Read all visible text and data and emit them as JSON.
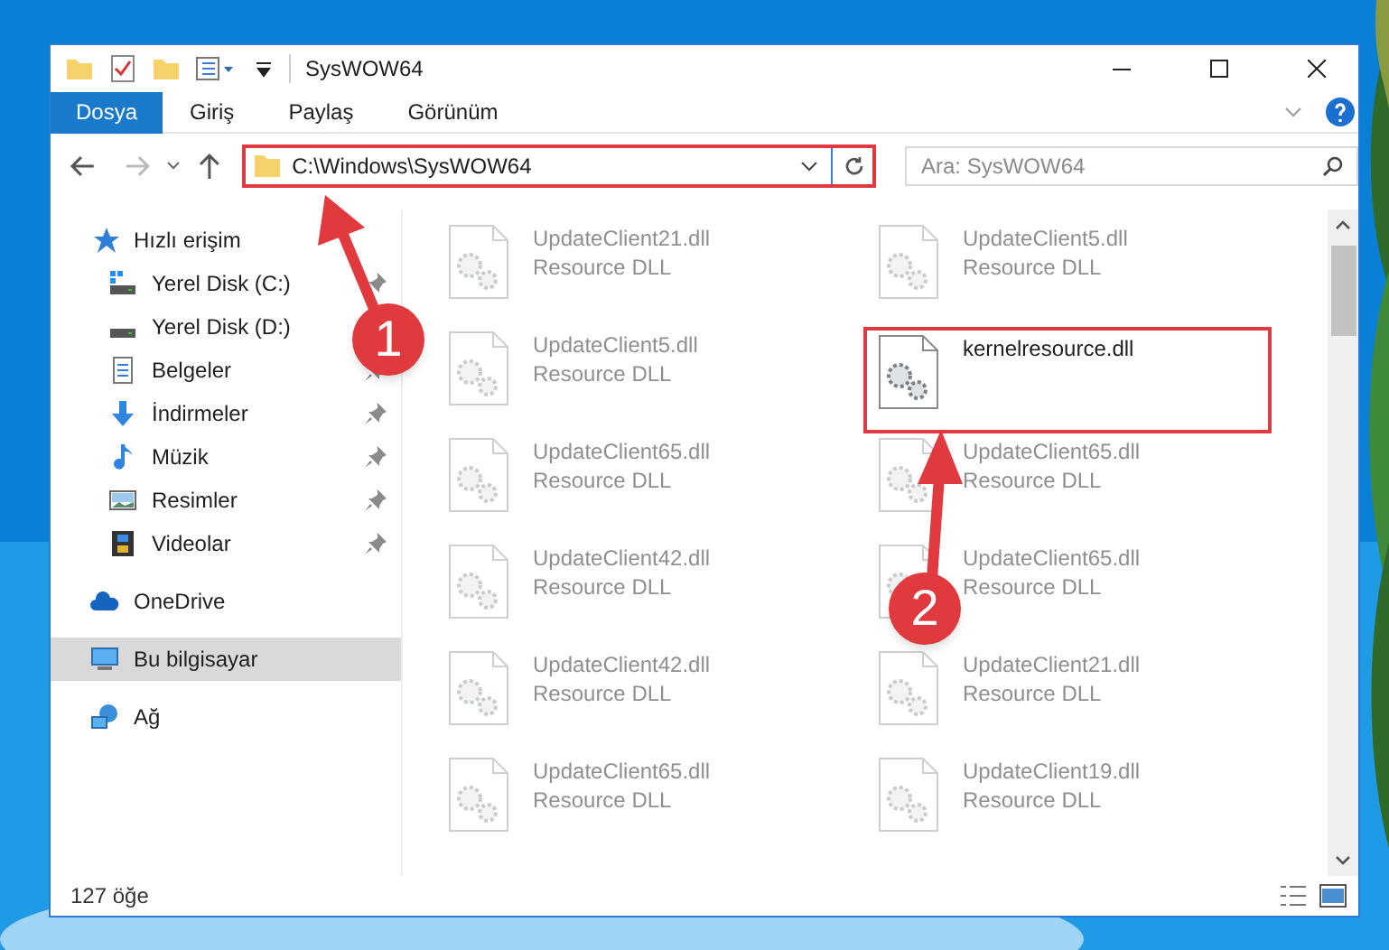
{
  "window": {
    "title": "SysWOW64"
  },
  "ribbon_tabs": [
    {
      "label": "Dosya",
      "kind": "file"
    },
    {
      "label": "Giriş",
      "kind": "tab"
    },
    {
      "label": "Paylaş",
      "kind": "tab"
    },
    {
      "label": "Görünüm",
      "kind": "tab"
    }
  ],
  "address_bar": {
    "path": "C:\\Windows\\SysWOW64"
  },
  "search": {
    "placeholder": "Ara: SysWOW64"
  },
  "sidebar": {
    "items": [
      {
        "label": "Hızlı erişim",
        "selected": false,
        "children": [
          {
            "label": "Yerel Disk (C:)",
            "pinned": true,
            "selected": false
          },
          {
            "label": "Yerel Disk (D:)",
            "selected": false
          },
          {
            "label": "Belgeler",
            "pinned": true,
            "selected": false
          },
          {
            "label": "İndirmeler",
            "pinned": true,
            "selected": false
          },
          {
            "label": "Müzik",
            "pinned": true,
            "selected": false
          },
          {
            "label": "Resimler",
            "pinned": true,
            "selected": false
          },
          {
            "label": "Videolar",
            "pinned": true,
            "selected": false
          }
        ]
      },
      {
        "label": "OneDrive",
        "selected": false
      },
      {
        "label": "Bu bilgisayar",
        "selected": true
      },
      {
        "label": "Ağ",
        "selected": false
      }
    ]
  },
  "files": [
    {
      "name": "UpdateClient21.dll",
      "type": "Resource DLL",
      "blurred": true,
      "highlighted": false
    },
    {
      "name": "UpdateClient5.dll",
      "type": "Resource DLL",
      "blurred": true,
      "highlighted": false
    },
    {
      "name": "UpdateClient5.dll",
      "type": "Resource DLL",
      "blurred": true,
      "highlighted": false
    },
    {
      "name": "kernelresource.dll",
      "blurred": false,
      "highlighted": true
    },
    {
      "name": "UpdateClient65.dll",
      "type": "Resource DLL",
      "blurred": true,
      "highlighted": false
    },
    {
      "name": "UpdateClient65.dll",
      "type": "Resource DLL",
      "blurred": true,
      "highlighted": false
    },
    {
      "name": "UpdateClient42.dll",
      "type": "Resource DLL",
      "blurred": true,
      "highlighted": false
    },
    {
      "name": "UpdateClient65.dll",
      "type": "Resource DLL",
      "blurred": true,
      "highlighted": false
    },
    {
      "name": "UpdateClient42.dll",
      "type": "Resource DLL",
      "blurred": true,
      "highlighted": false
    },
    {
      "name": "UpdateClient21.dll",
      "type": "Resource DLL",
      "blurred": true,
      "highlighted": false
    },
    {
      "name": "UpdateClient65.dll",
      "type": "Resource DLL",
      "blurred": true,
      "highlighted": false
    },
    {
      "name": "UpdateClient19.dll",
      "type": "Resource DLL",
      "blurred": true,
      "highlighted": false
    }
  ],
  "status_bar": {
    "count": "127 öğe"
  },
  "annotations": [
    {
      "label": "1"
    },
    {
      "label": "2"
    }
  ]
}
